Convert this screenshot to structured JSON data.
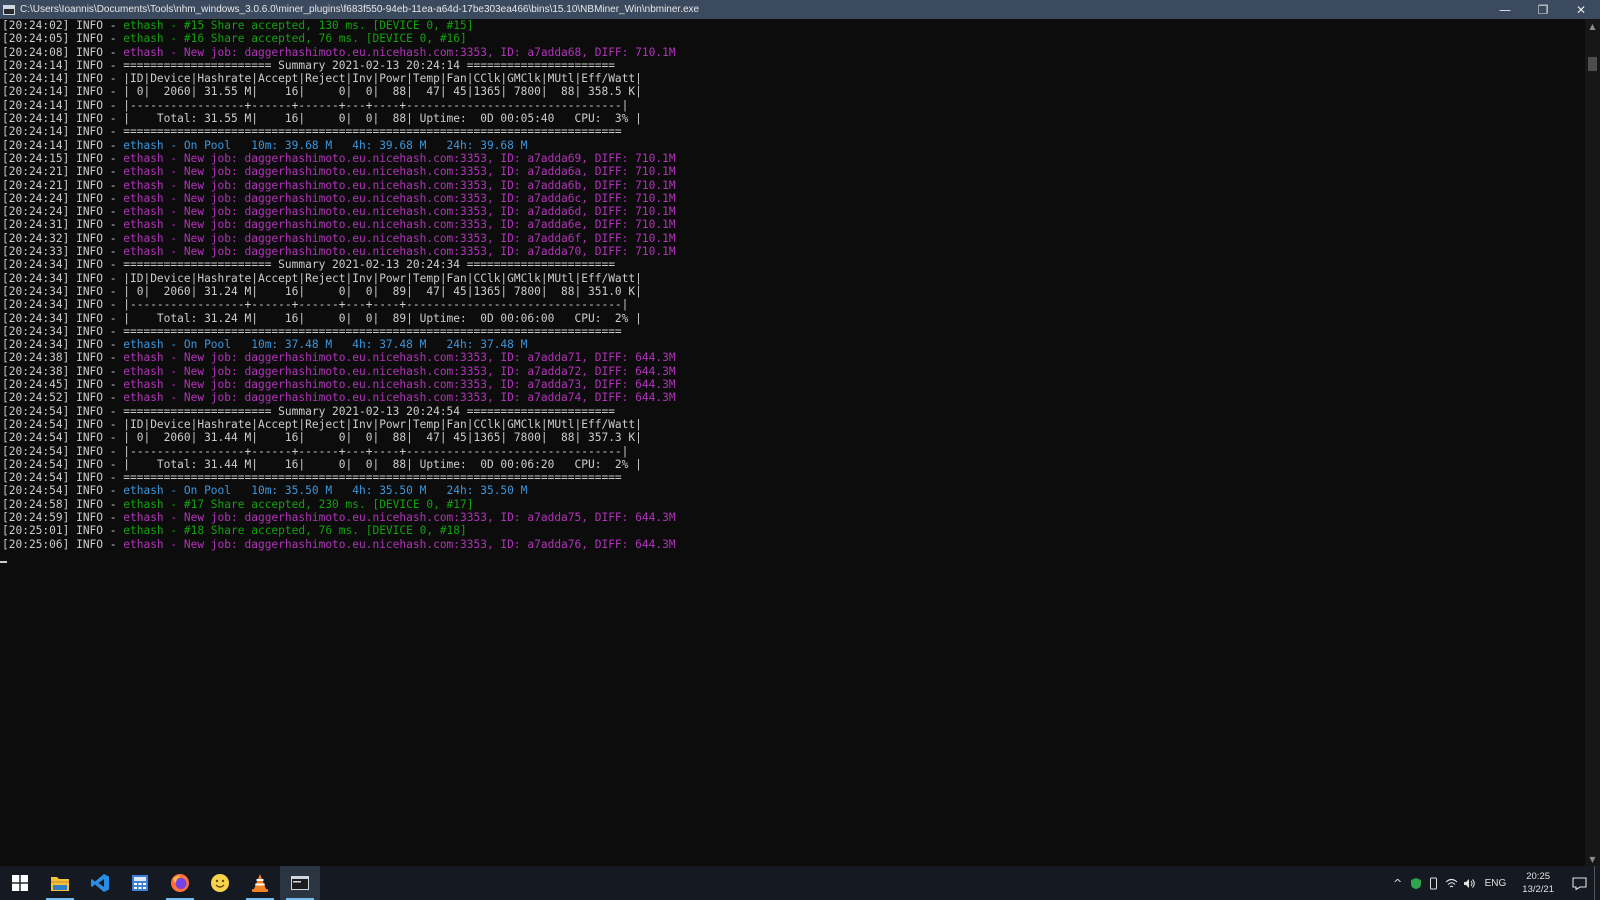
{
  "window": {
    "title": "C:\\Users\\Ioannis\\Documents\\Tools\\nhm_windows_3.0.6.0\\miner_plugins\\f683f550-94eb-11ea-a64d-17be303ea466\\bins\\15.10\\NBMiner_Win\\nbminer.exe",
    "minimize": "—",
    "restore": "❐",
    "close": "✕"
  },
  "colors": {
    "white": "#cccccc",
    "green": "#13a10e",
    "magenta": "#b133b9",
    "cyan": "#3a96dd"
  },
  "console": {
    "lines": [
      {
        "ts": "[20:24:02] INFO - ",
        "msg": "ethash - #15 Share accepted, 130 ms. [DEVICE 0, #15]",
        "color": "green"
      },
      {
        "ts": "[20:24:05] INFO - ",
        "msg": "ethash - #16 Share accepted, 76 ms. [DEVICE 0, #16]",
        "color": "green"
      },
      {
        "ts": "[20:24:08] INFO - ",
        "msg": "ethash - New job: daggerhashimoto.eu.nicehash.com:3353, ID: a7adda68, DIFF: 710.1M",
        "color": "magenta"
      },
      {
        "ts": "[20:24:14] INFO - ",
        "msg": "====================== Summary 2021-02-13 20:24:14 ======================",
        "color": "white"
      },
      {
        "ts": "[20:24:14] INFO - ",
        "msg": "|ID|Device|Hashrate|Accept|Reject|Inv|Powr|Temp|Fan|CClk|GMClk|MUtl|Eff/Watt|",
        "color": "white"
      },
      {
        "ts": "[20:24:14] INFO - ",
        "msg": "| 0|  2060| 31.55 M|    16|     0|  0|  88|  47| 45|1365| 7800|  88| 358.5 K|",
        "color": "white"
      },
      {
        "ts": "[20:24:14] INFO - ",
        "msg": "|-----------------+------+------+---+----+--------------------------------|",
        "color": "white"
      },
      {
        "ts": "[20:24:14] INFO - ",
        "msg": "|    Total: 31.55 M|    16|     0|  0|  88| Uptime:  0D 00:05:40   CPU:  3% |",
        "color": "white"
      },
      {
        "ts": "[20:24:14] INFO - ",
        "msg": "==========================================================================",
        "color": "white"
      },
      {
        "ts": "[20:24:14] INFO - ",
        "msg": "ethash - On Pool   10m: 39.68 M   4h: 39.68 M   24h: 39.68 M",
        "color": "cyan"
      },
      {
        "ts": "[20:24:15] INFO - ",
        "msg": "ethash - New job: daggerhashimoto.eu.nicehash.com:3353, ID: a7adda69, DIFF: 710.1M",
        "color": "magenta"
      },
      {
        "ts": "[20:24:21] INFO - ",
        "msg": "ethash - New job: daggerhashimoto.eu.nicehash.com:3353, ID: a7adda6a, DIFF: 710.1M",
        "color": "magenta"
      },
      {
        "ts": "[20:24:21] INFO - ",
        "msg": "ethash - New job: daggerhashimoto.eu.nicehash.com:3353, ID: a7adda6b, DIFF: 710.1M",
        "color": "magenta"
      },
      {
        "ts": "[20:24:24] INFO - ",
        "msg": "ethash - New job: daggerhashimoto.eu.nicehash.com:3353, ID: a7adda6c, DIFF: 710.1M",
        "color": "magenta"
      },
      {
        "ts": "[20:24:24] INFO - ",
        "msg": "ethash - New job: daggerhashimoto.eu.nicehash.com:3353, ID: a7adda6d, DIFF: 710.1M",
        "color": "magenta"
      },
      {
        "ts": "[20:24:31] INFO - ",
        "msg": "ethash - New job: daggerhashimoto.eu.nicehash.com:3353, ID: a7adda6e, DIFF: 710.1M",
        "color": "magenta"
      },
      {
        "ts": "[20:24:32] INFO - ",
        "msg": "ethash - New job: daggerhashimoto.eu.nicehash.com:3353, ID: a7adda6f, DIFF: 710.1M",
        "color": "magenta"
      },
      {
        "ts": "[20:24:33] INFO - ",
        "msg": "ethash - New job: daggerhashimoto.eu.nicehash.com:3353, ID: a7adda70, DIFF: 710.1M",
        "color": "magenta"
      },
      {
        "ts": "[20:24:34] INFO - ",
        "msg": "====================== Summary 2021-02-13 20:24:34 ======================",
        "color": "white"
      },
      {
        "ts": "[20:24:34] INFO - ",
        "msg": "|ID|Device|Hashrate|Accept|Reject|Inv|Powr|Temp|Fan|CClk|GMClk|MUtl|Eff/Watt|",
        "color": "white"
      },
      {
        "ts": "[20:24:34] INFO - ",
        "msg": "| 0|  2060| 31.24 M|    16|     0|  0|  89|  47| 45|1365| 7800|  88| 351.0 K|",
        "color": "white"
      },
      {
        "ts": "[20:24:34] INFO - ",
        "msg": "|-----------------+------+------+---+----+--------------------------------|",
        "color": "white"
      },
      {
        "ts": "[20:24:34] INFO - ",
        "msg": "|    Total: 31.24 M|    16|     0|  0|  89| Uptime:  0D 00:06:00   CPU:  2% |",
        "color": "white"
      },
      {
        "ts": "[20:24:34] INFO - ",
        "msg": "==========================================================================",
        "color": "white"
      },
      {
        "ts": "[20:24:34] INFO - ",
        "msg": "ethash - On Pool   10m: 37.48 M   4h: 37.48 M   24h: 37.48 M",
        "color": "cyan"
      },
      {
        "ts": "[20:24:38] INFO - ",
        "msg": "ethash - New job: daggerhashimoto.eu.nicehash.com:3353, ID: a7adda71, DIFF: 644.3M",
        "color": "magenta"
      },
      {
        "ts": "[20:24:38] INFO - ",
        "msg": "ethash - New job: daggerhashimoto.eu.nicehash.com:3353, ID: a7adda72, DIFF: 644.3M",
        "color": "magenta"
      },
      {
        "ts": "[20:24:45] INFO - ",
        "msg": "ethash - New job: daggerhashimoto.eu.nicehash.com:3353, ID: a7adda73, DIFF: 644.3M",
        "color": "magenta"
      },
      {
        "ts": "[20:24:52] INFO - ",
        "msg": "ethash - New job: daggerhashimoto.eu.nicehash.com:3353, ID: a7adda74, DIFF: 644.3M",
        "color": "magenta"
      },
      {
        "ts": "[20:24:54] INFO - ",
        "msg": "====================== Summary 2021-02-13 20:24:54 ======================",
        "color": "white"
      },
      {
        "ts": "[20:24:54] INFO - ",
        "msg": "|ID|Device|Hashrate|Accept|Reject|Inv|Powr|Temp|Fan|CClk|GMClk|MUtl|Eff/Watt|",
        "color": "white"
      },
      {
        "ts": "[20:24:54] INFO - ",
        "msg": "| 0|  2060| 31.44 M|    16|     0|  0|  88|  47| 45|1365| 7800|  88| 357.3 K|",
        "color": "white"
      },
      {
        "ts": "[20:24:54] INFO - ",
        "msg": "|-----------------+------+------+---+----+--------------------------------|",
        "color": "white"
      },
      {
        "ts": "[20:24:54] INFO - ",
        "msg": "|    Total: 31.44 M|    16|     0|  0|  88| Uptime:  0D 00:06:20   CPU:  2% |",
        "color": "white"
      },
      {
        "ts": "[20:24:54] INFO - ",
        "msg": "==========================================================================",
        "color": "white"
      },
      {
        "ts": "[20:24:54] INFO - ",
        "msg": "ethash - On Pool   10m: 35.50 M   4h: 35.50 M   24h: 35.50 M",
        "color": "cyan"
      },
      {
        "ts": "[20:24:58] INFO - ",
        "msg": "ethash - #17 Share accepted, 230 ms. [DEVICE 0, #17]",
        "color": "green"
      },
      {
        "ts": "[20:24:59] INFO - ",
        "msg": "ethash - New job: daggerhashimoto.eu.nicehash.com:3353, ID: a7adda75, DIFF: 644.3M",
        "color": "magenta"
      },
      {
        "ts": "[20:25:01] INFO - ",
        "msg": "ethash - #18 Share accepted, 76 ms. [DEVICE 0, #18]",
        "color": "green"
      },
      {
        "ts": "[20:25:06] INFO - ",
        "msg": "ethash - New job: daggerhashimoto.eu.nicehash.com:3353, ID: a7adda76, DIFF: 644.3M",
        "color": "magenta"
      }
    ]
  },
  "scrollbar": {
    "up": "▲",
    "down": "▼"
  },
  "taskbar": {
    "apps": [
      {
        "name": "start-button",
        "icon": "windows-logo-icon",
        "running": false,
        "active": false
      },
      {
        "name": "file-explorer",
        "icon": "folder-icon",
        "running": true,
        "active": false
      },
      {
        "name": "vscode",
        "icon": "vscode-icon",
        "running": false,
        "active": false
      },
      {
        "name": "calculator",
        "icon": "calculator-icon",
        "running": false,
        "active": false
      },
      {
        "name": "firefox",
        "icon": "firefox-icon",
        "running": true,
        "active": false
      },
      {
        "name": "emoji-app",
        "icon": "smiley-icon",
        "running": false,
        "active": false
      },
      {
        "name": "vlc",
        "icon": "vlc-cone-icon",
        "running": true,
        "active": false
      },
      {
        "name": "nbminer-console",
        "icon": "console-window-icon",
        "running": true,
        "active": true
      }
    ],
    "tray": {
      "chevron": "^",
      "language": "ENG",
      "time": "20:25",
      "date": "13/2/21"
    }
  }
}
